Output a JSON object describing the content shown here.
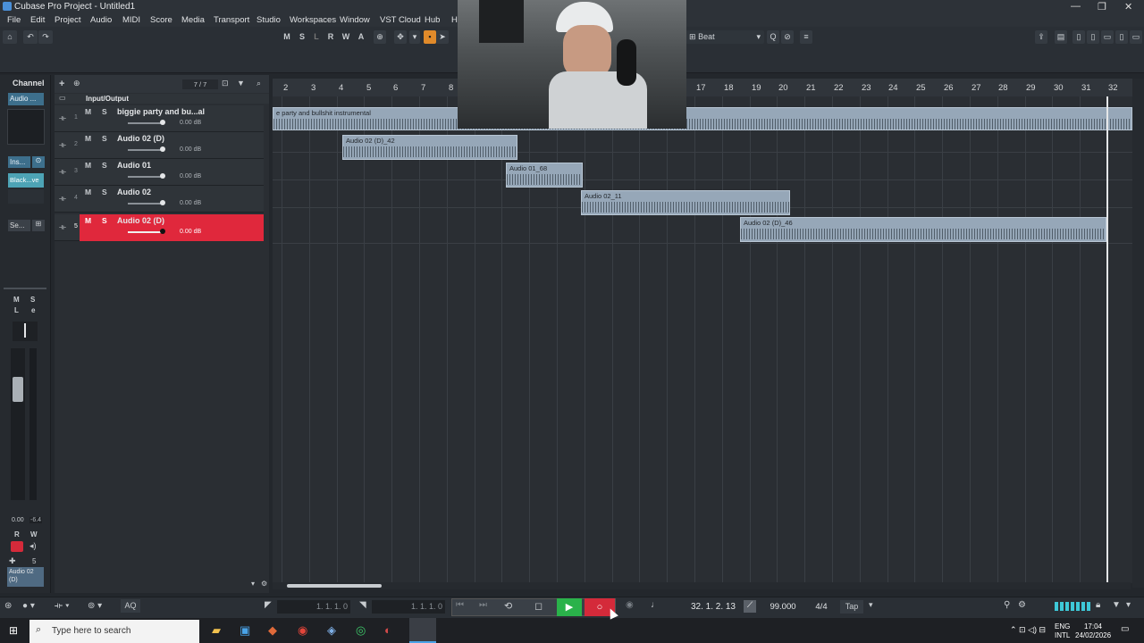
{
  "window": {
    "title": "Cubase Pro Project - Untitled1"
  },
  "menu": [
    "File",
    "Edit",
    "Project",
    "Audio",
    "MIDI",
    "Score",
    "Media",
    "Transport",
    "Studio",
    "Workspaces",
    "Window",
    "VST Cloud",
    "Hub",
    "H"
  ],
  "toolbar": {
    "modes": [
      "M",
      "S",
      "L",
      "R",
      "W",
      "A"
    ],
    "snap_label": "Beat"
  },
  "inspector": {
    "section": "Channel",
    "audio_btn": "Audio ...",
    "inserts_btn": "Ins...",
    "plugin_slot": "Black...ve",
    "sends_btn": "Se...",
    "m_btn": "M",
    "s_btn": "S",
    "l_btn": "L",
    "e_btn": "e",
    "val1": "0.00",
    "val2": "-6.4",
    "r_btn": "R",
    "w_btn": "W",
    "track_num": "5",
    "channel_name": "Audio 02 (D)"
  },
  "tracklist": {
    "counter": "7 / 7",
    "folder": "Input/Output",
    "tracks": [
      {
        "num": "1",
        "name": "biggie party and bu...al",
        "db": "0.00 dB"
      },
      {
        "num": "2",
        "name": "Audio 02 (D)",
        "db": "0.00 dB"
      },
      {
        "num": "3",
        "name": "Audio 01",
        "db": "0.00 dB"
      },
      {
        "num": "4",
        "name": "Audio 02",
        "db": "0.00 dB"
      },
      {
        "num": "5",
        "name": "Audio 02 (D)",
        "db": "0.00 dB"
      }
    ]
  },
  "ruler": [
    "2",
    "3",
    "4",
    "5",
    "6",
    "7",
    "8",
    "17",
    "18",
    "19",
    "20",
    "21",
    "22",
    "23",
    "24",
    "25",
    "26",
    "27",
    "28",
    "29",
    "30",
    "31",
    "32"
  ],
  "clips": [
    {
      "label": "e party and bullshit instrumental"
    },
    {
      "label": "Audio 02 (D)_42"
    },
    {
      "label": "Audio 01_68"
    },
    {
      "label": "Audio 02_11"
    },
    {
      "label": "Audio 02 (D)_46"
    }
  ],
  "transport": {
    "left_locator": "1. 1. 1.   0",
    "right_locator": "1. 1. 1.   0",
    "position": "32. 1. 2. 13",
    "tempo": "99.000",
    "signature": "4/4",
    "tap": "Tap",
    "aq": "AQ"
  },
  "taskbar": {
    "search_placeholder": "Type here to search",
    "lang1": "ENG",
    "lang2": "INTL",
    "time": "17:04",
    "date": "24/02/2026"
  },
  "colors": {
    "selected_track": "#e0283c",
    "clip": "#96a7b8",
    "play": "#2ab24a",
    "record": "#d42a3a"
  }
}
